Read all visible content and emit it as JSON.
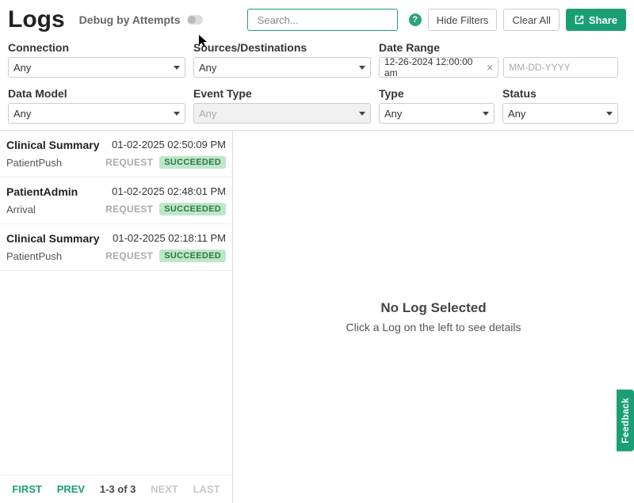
{
  "header": {
    "title": "Logs",
    "debug_label": "Debug by Attempts",
    "search_placeholder": "Search...",
    "help_symbol": "?",
    "hide_filters": "Hide Filters",
    "clear_all": "Clear All",
    "share": "Share"
  },
  "filters": {
    "connection": {
      "label": "Connection",
      "value": "Any"
    },
    "sources": {
      "label": "Sources/Destinations",
      "value": "Any"
    },
    "date_range": {
      "label": "Date Range",
      "start": "12-26-2024 12:00:00 am",
      "end_placeholder": "MM-DD-YYYY",
      "clear_symbol": "×"
    },
    "data_model": {
      "label": "Data Model",
      "value": "Any"
    },
    "event_type": {
      "label": "Event Type",
      "placeholder": "Any"
    },
    "type": {
      "label": "Type",
      "value": "Any"
    },
    "status": {
      "label": "Status",
      "value": "Any"
    }
  },
  "logs": [
    {
      "title": "Clinical Summary",
      "timestamp": "01-02-2025 02:50:09 PM",
      "subtitle": "PatientPush",
      "kind": "REQUEST",
      "status": "SUCCEEDED"
    },
    {
      "title": "PatientAdmin",
      "timestamp": "01-02-2025 02:48:01 PM",
      "subtitle": "Arrival",
      "kind": "REQUEST",
      "status": "SUCCEEDED"
    },
    {
      "title": "Clinical Summary",
      "timestamp": "01-02-2025 02:18:11 PM",
      "subtitle": "PatientPush",
      "kind": "REQUEST",
      "status": "SUCCEEDED"
    }
  ],
  "pagination": {
    "first": "FIRST",
    "prev": "PREV",
    "info": "1-3 of 3",
    "next": "NEXT",
    "last": "LAST"
  },
  "detail": {
    "empty_title": "No Log Selected",
    "empty_sub": "Click a Log on the left to see details"
  },
  "feedback_tab": "Feedback",
  "colors": {
    "accent": "#1a9e74",
    "success_bg": "#bfe6cb",
    "success_fg": "#2a7a3c"
  }
}
